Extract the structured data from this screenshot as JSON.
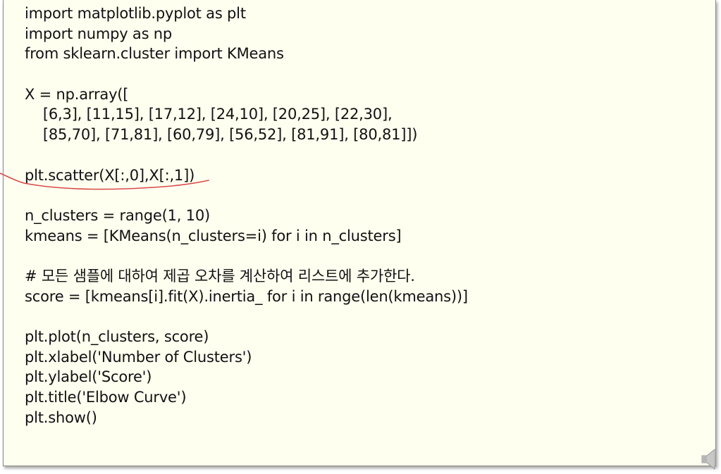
{
  "code": {
    "lines": [
      "import matplotlib.pyplot as plt",
      "import numpy as np",
      "from sklearn.cluster import KMeans",
      "",
      "X = np.array([",
      "    [6,3], [11,15], [17,12], [24,10], [20,25], [22,30],",
      "    [85,70], [71,81], [60,79], [56,52], [81,91], [80,81]])",
      "",
      "plt.scatter(X[:,0],X[:,1])",
      "",
      "n_clusters = range(1, 10)",
      "kmeans = [KMeans(n_clusters=i) for i in n_clusters]",
      "",
      "# 모든 샘플에 대하여 제곱 오차를 계산하여 리스트에 추가한다.",
      "score = [kmeans[i].fit(X).inertia_ for i in range(len(kmeans))]",
      "",
      "plt.plot(n_clusters, score)",
      "plt.xlabel('Number of Clusters')",
      "plt.ylabel('Score')",
      "plt.title('Elbow Curve')",
      "plt.show()"
    ]
  },
  "colors": {
    "box_background": "#fffff0",
    "text": "#111111",
    "annotation_stroke": "#d94a4a"
  },
  "icons": {
    "speaker": "speaker-icon"
  }
}
